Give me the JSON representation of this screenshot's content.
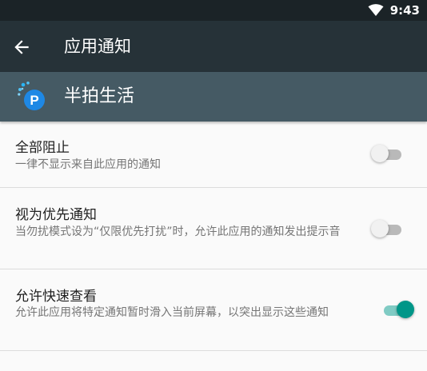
{
  "status_bar": {
    "time": "9:43"
  },
  "app_bar": {
    "title": "应用通知"
  },
  "app_header": {
    "name": "半拍生活"
  },
  "settings": [
    {
      "title": "全部阻止",
      "summary": "一律不显示来自此应用的通知",
      "enabled": false
    },
    {
      "title": "视为优先通知",
      "summary": "当勿扰模式设为“仅限优先打扰”时，允许此应用的通知发出提示音",
      "enabled": false
    },
    {
      "title": "允许快速查看",
      "summary": "允许此应用将特定通知暂时滑入当前屏幕，以突出显示这些通知",
      "enabled": true
    }
  ],
  "colors": {
    "status_bar": "#1b2327",
    "app_bar": "#263238",
    "app_header": "#455a64",
    "accent": "#009688"
  }
}
